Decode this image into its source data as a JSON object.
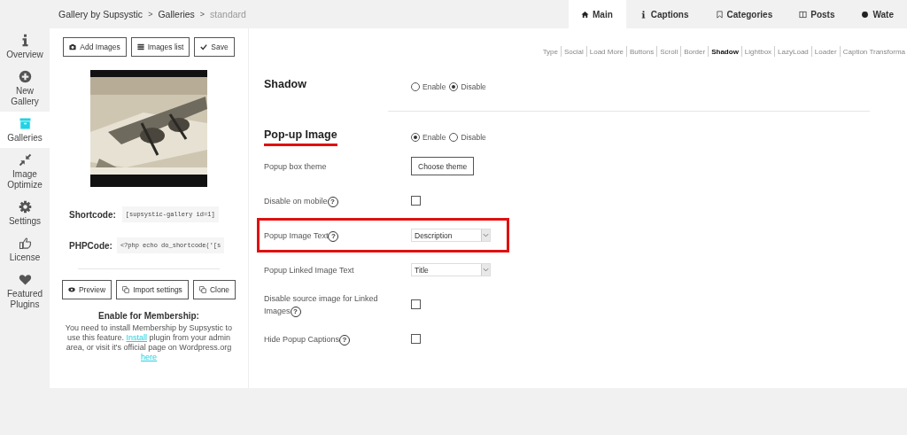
{
  "breadcrumb": [
    {
      "label": "Gallery by Supsystic",
      "current": false
    },
    {
      "label": "Galleries",
      "current": false
    },
    {
      "label": "standard",
      "current": true
    }
  ],
  "breadcrumb_separator": ">",
  "top_tabs": [
    {
      "label": "Main",
      "selected": true
    },
    {
      "label": "Captions",
      "selected": false
    },
    {
      "label": "Categories",
      "selected": false
    },
    {
      "label": "Posts",
      "selected": false
    },
    {
      "label": "Wate",
      "selected": false
    }
  ],
  "sidebar": {
    "items": [
      {
        "label": "Overview",
        "selected": false
      },
      {
        "label": "New Gallery",
        "selected": false
      },
      {
        "label": "Galleries",
        "selected": true
      },
      {
        "label": "Image Optimize",
        "selected": false
      },
      {
        "label": "Settings",
        "selected": false
      },
      {
        "label": "License",
        "selected": false
      },
      {
        "label": "Featured Plugins",
        "selected": false
      }
    ]
  },
  "toolbar": [
    "Add Images",
    "Images list",
    "Save"
  ],
  "preview": {
    "kind": "picture"
  },
  "codes": [
    {
      "label": "Shortcode:",
      "value": "[supsystic-gallery id=1]"
    },
    {
      "label": "PHPCode:",
      "value": "<?php echo do_shortcode('[s"
    }
  ],
  "actions": [
    "Preview",
    "Import settings",
    "Clone"
  ],
  "membership": {
    "title": "Enable for Membership:",
    "parts": [
      {
        "text": "You need to install Membership by Supsystic to use this feature. ",
        "link": false
      },
      {
        "text": "Install",
        "link": true
      },
      {
        "text": " plugin from your admin area, or visit it's official page on Wordpress.org ",
        "link": false
      },
      {
        "text": "here",
        "link": true
      }
    ]
  },
  "sub_nav": [
    {
      "label": "Type",
      "selected": false
    },
    {
      "label": "Social",
      "selected": false
    },
    {
      "label": "Load More",
      "selected": false
    },
    {
      "label": "Buttons",
      "selected": false
    },
    {
      "label": "Scroll",
      "selected": false
    },
    {
      "label": "Border",
      "selected": false
    },
    {
      "label": "Shadow",
      "selected": true
    },
    {
      "label": "Lightbox",
      "selected": false
    },
    {
      "label": "LazyLoad",
      "selected": false
    },
    {
      "label": "Loader",
      "selected": false
    },
    {
      "label": "Caption Transforma",
      "selected": false
    }
  ],
  "sections": [
    {
      "title": "Shadow",
      "highlighted": false,
      "options": [
        {
          "label": "Enable",
          "selected": false
        },
        {
          "label": "Disable",
          "selected": true
        }
      ]
    },
    {
      "title": "Pop-up Image",
      "highlighted": true,
      "options": [
        {
          "label": "Enable",
          "selected": true
        },
        {
          "label": "Disable",
          "selected": false
        }
      ],
      "rows": [
        {
          "kind": "button",
          "label": "Popup box theme",
          "button": "Choose theme"
        },
        {
          "kind": "checkbox",
          "label": "Disable on mobile",
          "help": "?",
          "checked": false
        },
        {
          "kind": "select",
          "label": "Popup Image Text",
          "help": "?",
          "value": "Description",
          "highlighted": true
        },
        {
          "kind": "select",
          "label": "Popup Linked Image Text",
          "value": "Title",
          "highlighted": false
        },
        {
          "kind": "checkbox",
          "label": "Disable source image for Linked Images",
          "help": "?",
          "checked": false
        },
        {
          "kind": "checkbox",
          "label": "Hide Popup Captions",
          "help": "?",
          "checked": false
        }
      ]
    }
  ]
}
